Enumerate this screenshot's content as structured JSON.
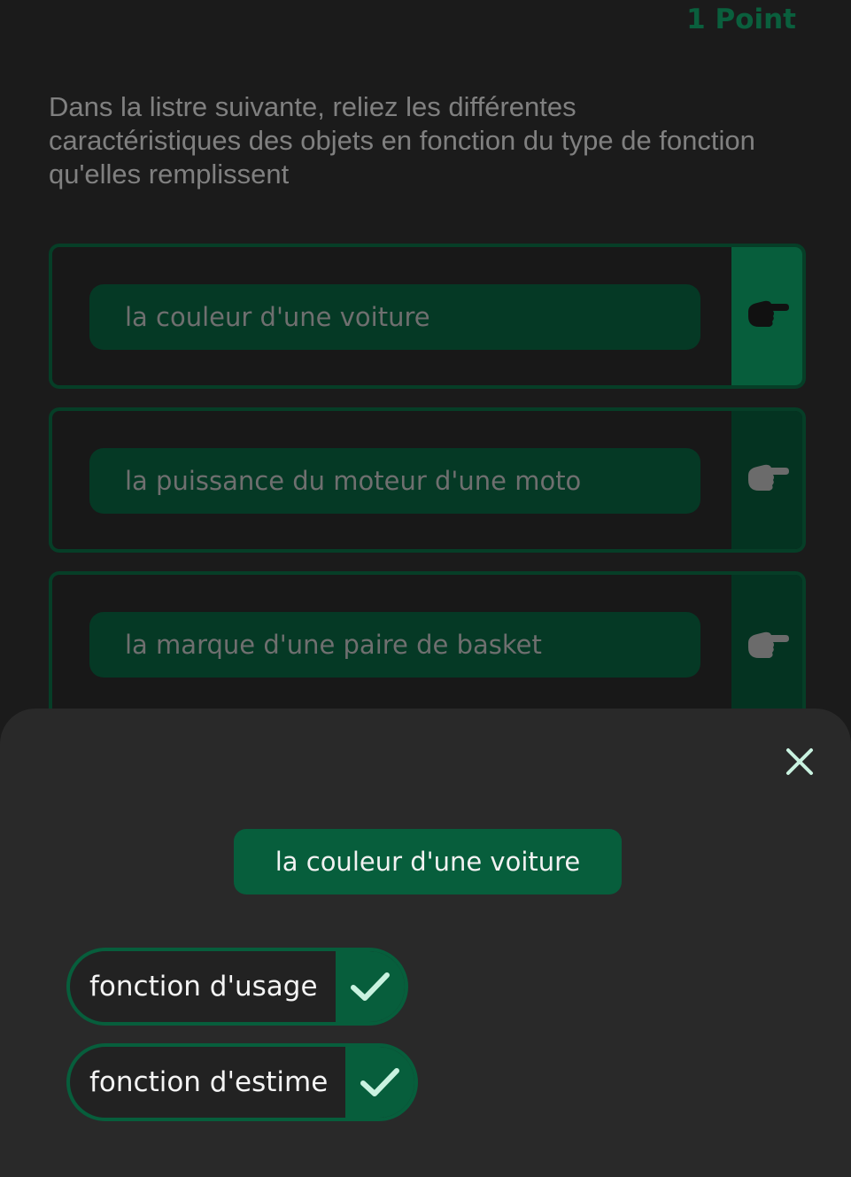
{
  "header": {
    "points": "1 Point"
  },
  "question": {
    "line1": "Dans la listre suivante, reliez les différentes",
    "line2": "caractéristiques des objets en fonction du type de fonction",
    "line3": "qu'elles remplissent"
  },
  "items": [
    {
      "label": "la couleur d'une voiture",
      "icon": "pointing-hand-icon",
      "active": true
    },
    {
      "label": "la puissance du moteur d'une moto",
      "icon": "pointing-hand-icon",
      "active": false
    },
    {
      "label": "la marque d'une paire de basket",
      "icon": "pointing-hand-icon",
      "active": false
    }
  ],
  "sheet": {
    "close_icon": "close-icon",
    "selected_item": "la couleur d'une voiture",
    "options": [
      {
        "label": "fonction d'usage",
        "icon": "check-icon"
      },
      {
        "label": "fonction d'estime",
        "icon": "check-icon"
      }
    ]
  },
  "colors": {
    "accent": "#075e3c",
    "accent_dark": "#053925",
    "background": "#1b1b1b",
    "sheet": "#292929"
  }
}
